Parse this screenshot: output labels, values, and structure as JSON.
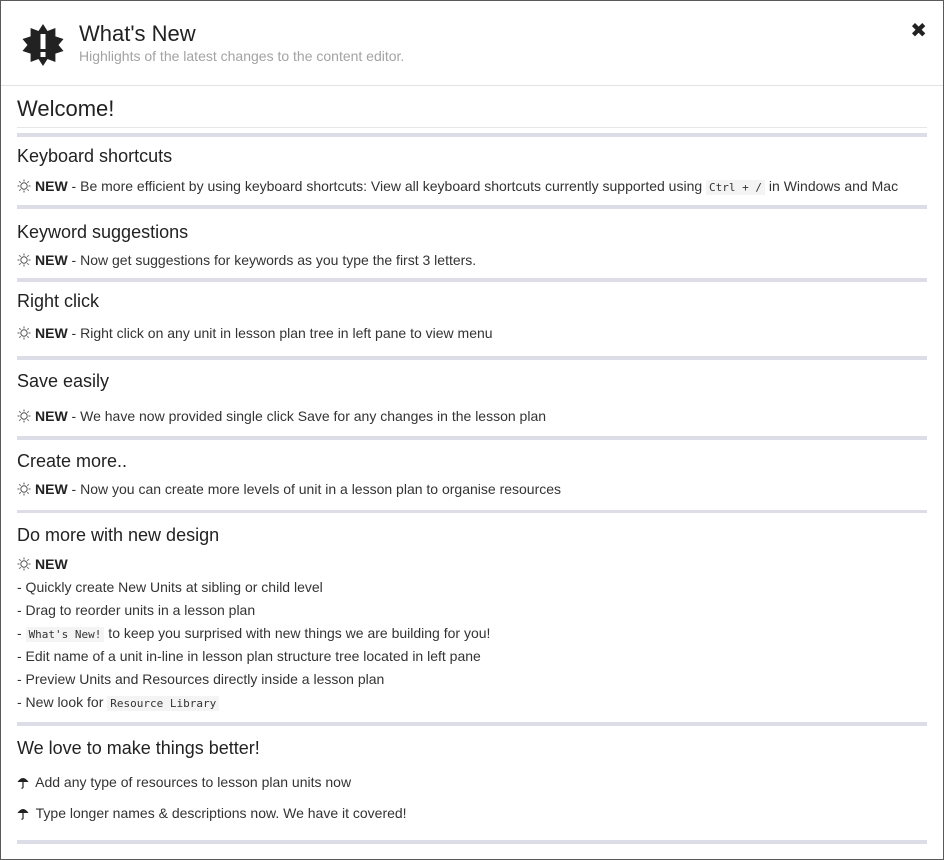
{
  "header": {
    "title": "What's New",
    "subtitle": "Highlights of the latest changes to the content editor.",
    "close_glyph": "✖",
    "badge_icon": "alert-badge-icon"
  },
  "welcome": "Welcome!",
  "new_label": "NEW",
  "sections": {
    "keyboard": {
      "title": "Keyboard shortcuts",
      "text_before": " - Be more efficient by using keyboard shortcuts: View all keyboard shortcuts currently supported using ",
      "code": "Ctrl + /",
      "text_after": " in Windows and Mac"
    },
    "keyword": {
      "title": "Keyword suggestions",
      "text": " - Now get suggestions for keywords as you type the first 3 letters."
    },
    "rightclick": {
      "title": "Right click",
      "text": " - Right click on any unit in lesson plan tree in left pane to view menu"
    },
    "save": {
      "title": "Save easily",
      "text": " - We have now provided single click Save for any changes in the lesson plan"
    },
    "create": {
      "title": "Create more..",
      "text": " - Now you can create more levels of unit in a lesson plan to organise resources"
    },
    "design": {
      "title": "Do more with new design",
      "items": {
        "i1": "- Quickly create New Units at sibling or child level",
        "i2": "- Drag to reorder units in a lesson plan",
        "i3_prefix": "- ",
        "i3_code": "What's New!",
        "i3_suffix": " to keep you surprised with new things we are building for you!",
        "i4": "- Edit name of a unit in-line in lesson plan structure tree located in left pane",
        "i5": "- Preview Units and Resources directly inside a lesson plan",
        "i6_prefix": "- New look for ",
        "i6_code": "Resource Library"
      }
    },
    "better": {
      "title": "We love to make things better!",
      "item1": " Add any type of resources to lesson plan units now",
      "item2": " Type longer names & descriptions now. We have it covered!"
    }
  },
  "icons": {
    "sun": "sun-icon",
    "umbrella": "umbrella-icon"
  }
}
